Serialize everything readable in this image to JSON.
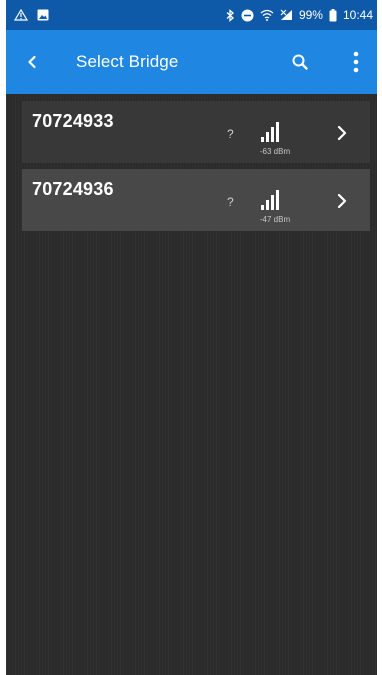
{
  "status_bar": {
    "battery_percent": "99%",
    "time": "10:44",
    "left_icons": [
      "signal-alert-icon",
      "gallery-icon"
    ],
    "right_icons": [
      "bluetooth-icon",
      "do-not-disturb-icon",
      "wifi-icon",
      "mobile-signal-icon",
      "battery-icon"
    ]
  },
  "app_bar": {
    "title": "Select Bridge",
    "back_icon": "chevron-left-icon",
    "search_icon": "search-icon",
    "menu_icon": "more-vertical-icon"
  },
  "bridges": [
    {
      "id": "70724933",
      "question": "?",
      "signal_dbm": "-63 dBm",
      "selected": false
    },
    {
      "id": "70724936",
      "question": "?",
      "signal_dbm": "-47 dBm",
      "selected": true
    }
  ],
  "colors": {
    "status_bar": "#0e5aa8",
    "app_bar": "#1f86e1",
    "background": "#2b2b2b",
    "row": "#383838",
    "row_selected": "#484848"
  }
}
